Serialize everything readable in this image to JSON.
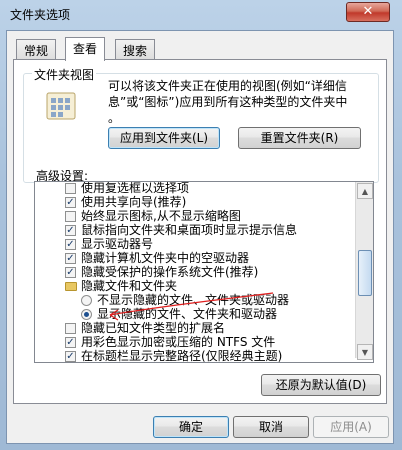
{
  "window": {
    "title": "文件夹选项",
    "close_glyph": "✕"
  },
  "tabs": [
    {
      "label": "常规",
      "active": false
    },
    {
      "label": "查看",
      "active": true
    },
    {
      "label": "搜索",
      "active": false
    }
  ],
  "folder_views": {
    "group_label": "文件夹视图",
    "description_line1": "可以将该文件夹正在使用的视图(例如“详细信",
    "description_line2": "息”或“图标”)应用到所有这种类型的文件夹中",
    "description_line3": "。",
    "apply_button": "应用到文件夹(L)",
    "reset_button": "重置文件夹(R)"
  },
  "advanced": {
    "label": "高级设置:",
    "items": [
      {
        "type": "checkbox",
        "checked": false,
        "label": "使用复选框以选择项",
        "indent": 1
      },
      {
        "type": "checkbox",
        "checked": true,
        "label": "使用共享向导(推荐)",
        "indent": 1
      },
      {
        "type": "checkbox",
        "checked": false,
        "label": "始终显示图标,从不显示缩略图",
        "indent": 1
      },
      {
        "type": "checkbox",
        "checked": true,
        "label": "鼠标指向文件夹和桌面项时显示提示信息",
        "indent": 1
      },
      {
        "type": "checkbox",
        "checked": true,
        "label": "显示驱动器号",
        "indent": 1
      },
      {
        "type": "checkbox",
        "checked": true,
        "label": "隐藏计算机文件夹中的空驱动器",
        "indent": 1
      },
      {
        "type": "checkbox",
        "checked": true,
        "label": "隐藏受保护的操作系统文件(推荐)",
        "indent": 1
      },
      {
        "type": "folder",
        "label": "隐藏文件和文件夹",
        "indent": 1
      },
      {
        "type": "radio",
        "checked": false,
        "label": "不显示隐藏的文件、文件夹或驱动器",
        "indent": 2
      },
      {
        "type": "radio",
        "checked": true,
        "label": "显示隐藏的文件、文件夹和驱动器",
        "indent": 2
      },
      {
        "type": "checkbox",
        "checked": false,
        "label": "隐藏已知文件类型的扩展名",
        "indent": 1
      },
      {
        "type": "checkbox",
        "checked": true,
        "label": "用彩色显示加密或压缩的 NTFS 文件",
        "indent": 1
      },
      {
        "type": "checkbox",
        "checked": true,
        "label": "在标题栏显示完整路径(仅限经典主题)",
        "indent": 1
      }
    ],
    "restore_button": "还原为默认值(D)"
  },
  "footer": {
    "ok_button": "确定",
    "cancel_button": "取消",
    "apply_button": "应用(A)"
  },
  "icons": {
    "scroll_up": "▲",
    "scroll_down": "▼",
    "annotation_color": "#e02020",
    "close_button_color": "#c0392b"
  }
}
